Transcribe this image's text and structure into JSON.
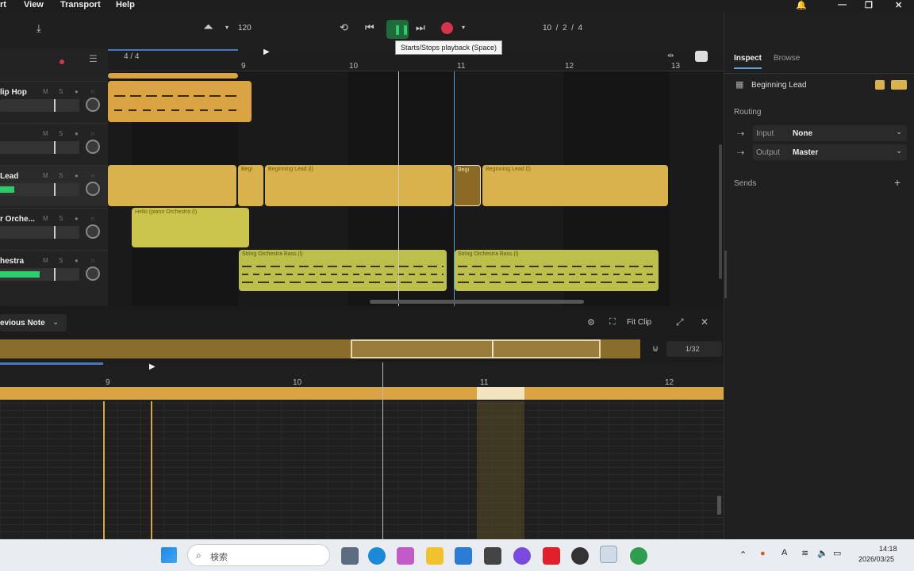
{
  "menu": {
    "items": [
      "rt",
      "View",
      "Transport",
      "Help"
    ]
  },
  "toolbar": {
    "tempo": "120",
    "position": "10  /  2  /  4",
    "time_sig": "4 / 4",
    "tooltip": "Starts/Stops playback (Space)"
  },
  "tracks": [
    {
      "name": "lip Hop",
      "meter": 0.0
    },
    {
      "name": "",
      "meter": 0.0
    },
    {
      "name": "Lead",
      "meter": 0.18
    },
    {
      "name": "r Orche...",
      "meter": 0.0
    },
    {
      "name": "hestra",
      "meter": 0.5
    }
  ],
  "ruler": {
    "marks": [
      "9",
      "10",
      "11",
      "12",
      "13"
    ]
  },
  "clips": {
    "lead_a": "Begi",
    "lead_b": "Beginning Lead (l)",
    "lead_c": "Begi",
    "lead_d": "Beginning Lead (l)",
    "orch": "Hello (piano Orchestra (l)",
    "string_a": "String Orchestra Bass (l)",
    "string_b": "String Orchestra Bass (l)"
  },
  "editor": {
    "mode": "evious Note",
    "fit_label": "Fit Clip",
    "grid": "1/32",
    "ruler": [
      "9",
      "10",
      "11",
      "12"
    ]
  },
  "inspector": {
    "tabs": [
      "Inspect",
      "Browse"
    ],
    "track_name": "Beginning Lead",
    "routing_label": "Routing",
    "input_label": "Input",
    "input_value": "None",
    "output_label": "Output",
    "output_value": "Master",
    "sends_label": "Sends",
    "meter_level": 0.7
  },
  "taskbar": {
    "search_placeholder": "検索",
    "time": "14:18",
    "date": "2026/03/25"
  },
  "colors": {
    "accent_green": "#2ccd6a",
    "clip_orange": "#d9a441",
    "clip_gold": "#d8b24a",
    "clip_olive": "#bcc04a"
  }
}
